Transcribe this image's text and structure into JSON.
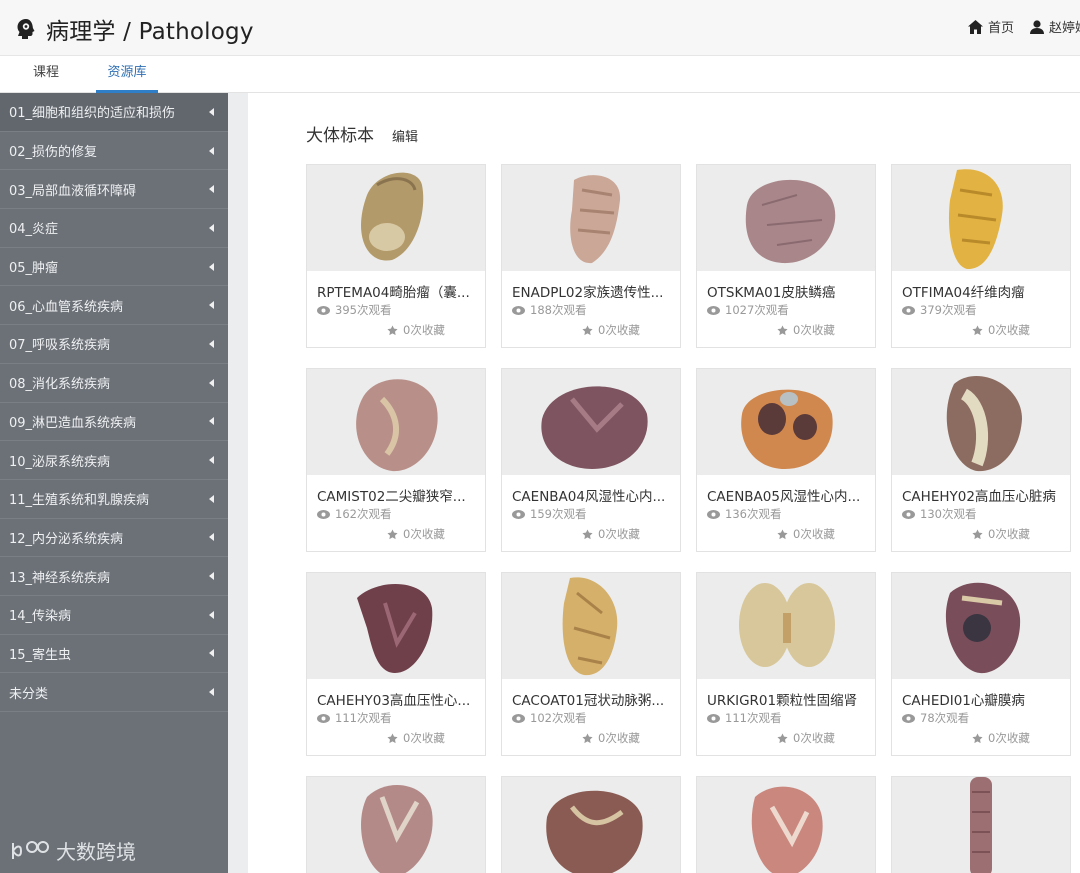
{
  "header": {
    "title": "病理学 / Pathology",
    "home_label": "首页",
    "user_name": "赵婷婷"
  },
  "tabs": [
    {
      "label": "课程"
    },
    {
      "label": "资源库"
    }
  ],
  "sidebar": {
    "items": [
      {
        "label": "01_细胞和组织的适应和损伤"
      },
      {
        "label": "02_损伤的修复"
      },
      {
        "label": "03_局部血液循环障碍"
      },
      {
        "label": "04_炎症"
      },
      {
        "label": "05_肿瘤"
      },
      {
        "label": "06_心血管系统疾病"
      },
      {
        "label": "07_呼吸系统疾病"
      },
      {
        "label": "08_消化系统疾病"
      },
      {
        "label": "09_淋巴造血系统疾病"
      },
      {
        "label": "10_泌尿系统疾病"
      },
      {
        "label": "11_生殖系统和乳腺疾病"
      },
      {
        "label": "12_内分泌系统疾病"
      },
      {
        "label": "13_神经系统疾病"
      },
      {
        "label": "14_传染病"
      },
      {
        "label": "15_寄生虫"
      },
      {
        "label": "未分类"
      }
    ],
    "watermark": "大数跨境"
  },
  "main": {
    "section_title": "大体标本",
    "edit_label": "编辑",
    "cards": [
      {
        "name": "RPTEMA04畸胎瘤（囊...",
        "views": "395次观看",
        "favs": "0次收藏"
      },
      {
        "name": "ENADPL02家族遗传性...",
        "views": "188次观看",
        "favs": "0次收藏"
      },
      {
        "name": "OTSKMA01皮肤鳞癌",
        "views": "1027次观看",
        "favs": "0次收藏"
      },
      {
        "name": "OTFIMA04纤维肉瘤",
        "views": "379次观看",
        "favs": "0次收藏"
      },
      {
        "name": "CAMIST02二尖瓣狭窄...",
        "views": "162次观看",
        "favs": "0次收藏"
      },
      {
        "name": "CAENBA04风湿性心内...",
        "views": "159次观看",
        "favs": "0次收藏"
      },
      {
        "name": "CAENBA05风湿性心内...",
        "views": "136次观看",
        "favs": "0次收藏"
      },
      {
        "name": "CAHEHY02高血压心脏病",
        "views": "130次观看",
        "favs": "0次收藏"
      },
      {
        "name": "CAHEHY03高血压性心...",
        "views": "111次观看",
        "favs": "0次收藏"
      },
      {
        "name": "CACOAT01冠状动脉粥...",
        "views": "102次观看",
        "favs": "0次收藏"
      },
      {
        "name": "URKIGR01颗粒性固缩肾",
        "views": "111次观看",
        "favs": "0次收藏"
      },
      {
        "name": "CAHEDI01心瓣膜病",
        "views": "78次观看",
        "favs": "0次收藏"
      }
    ]
  },
  "colors": {
    "sidebar_bg": "#6c7177",
    "accent": "#2f7fc8"
  }
}
